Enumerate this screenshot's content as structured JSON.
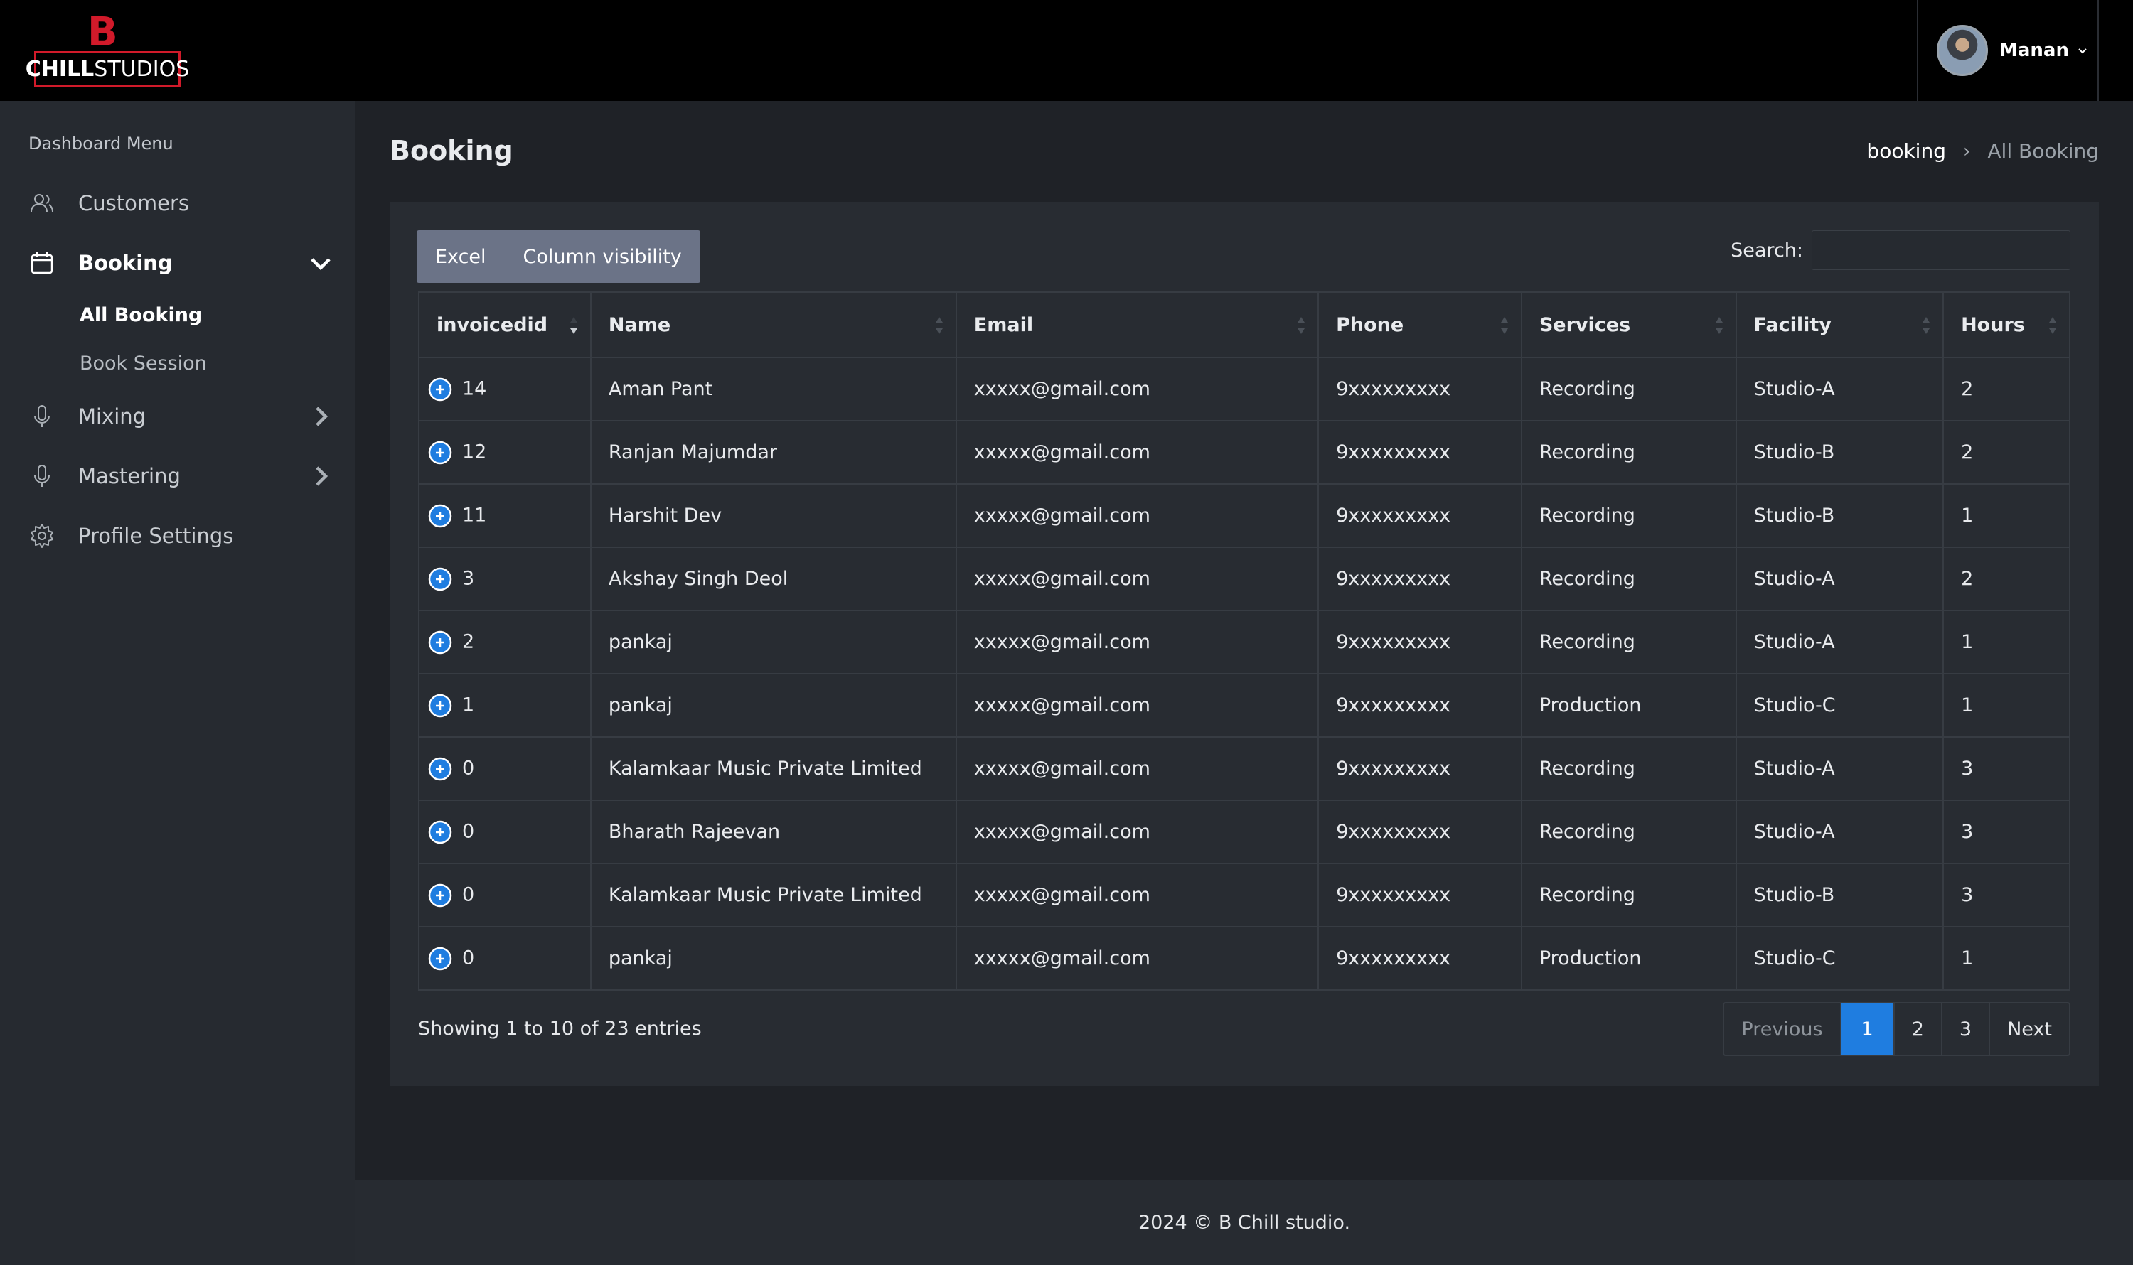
{
  "brand": {
    "logo_letter": "B",
    "logo_bold": "CHILL",
    "logo_light": "STUDIOS"
  },
  "user": {
    "name": "Manan"
  },
  "sidebar": {
    "menu_title": "Dashboard Menu",
    "items": [
      {
        "label": "Customers"
      },
      {
        "label": "Booking"
      },
      {
        "label": "Mixing"
      },
      {
        "label": "Mastering"
      },
      {
        "label": "Profile Settings"
      }
    ],
    "booking_sub": [
      {
        "label": "All Booking"
      },
      {
        "label": "Book Session"
      }
    ]
  },
  "page": {
    "title": "Booking",
    "breadcrumb": {
      "link": "booking",
      "current": "All Booking"
    }
  },
  "toolbar": {
    "excel": "Excel",
    "column_visibility": "Column visibility"
  },
  "search": {
    "label": "Search:",
    "value": ""
  },
  "table": {
    "headers": [
      "invoicedid",
      "Name",
      "Email",
      "Phone",
      "Services",
      "Facility",
      "Hours"
    ],
    "rows": [
      [
        "14",
        "Aman Pant",
        "xxxxx@gmail.com",
        "9xxxxxxxxx",
        "Recording",
        "Studio-A",
        "2"
      ],
      [
        "12",
        "Ranjan Majumdar",
        "xxxxx@gmail.com",
        "9xxxxxxxxx",
        "Recording",
        "Studio-B",
        "2"
      ],
      [
        "11",
        "Harshit Dev",
        "xxxxx@gmail.com",
        "9xxxxxxxxx",
        "Recording",
        "Studio-B",
        "1"
      ],
      [
        "3",
        "Akshay Singh Deol",
        "xxxxx@gmail.com",
        "9xxxxxxxxx",
        "Recording",
        "Studio-A",
        "2"
      ],
      [
        "2",
        "pankaj",
        "xxxxx@gmail.com",
        "9xxxxxxxxx",
        "Recording",
        "Studio-A",
        "1"
      ],
      [
        "1",
        "pankaj",
        "xxxxx@gmail.com",
        "9xxxxxxxxx",
        "Production",
        "Studio-C",
        "1"
      ],
      [
        "0",
        "Kalamkaar Music Private Limited",
        "xxxxx@gmail.com",
        "9xxxxxxxxx",
        "Recording",
        "Studio-A",
        "3"
      ],
      [
        "0",
        "Bharath Rajeevan",
        "xxxxx@gmail.com",
        "9xxxxxxxxx",
        "Recording",
        "Studio-A",
        "3"
      ],
      [
        "0",
        "Kalamkaar Music Private Limited",
        "xxxxx@gmail.com",
        "9xxxxxxxxx",
        "Recording",
        "Studio-B",
        "3"
      ],
      [
        "0",
        "pankaj",
        "xxxxx@gmail.com",
        "9xxxxxxxxx",
        "Production",
        "Studio-C",
        "1"
      ]
    ]
  },
  "pagination": {
    "info": "Showing 1 to 10 of 23 entries",
    "previous": "Previous",
    "pages": [
      "1",
      "2",
      "3"
    ],
    "next": "Next"
  },
  "footer": {
    "text": "2024 © B Chill studio."
  },
  "colors": {
    "accent": "#1f7de0",
    "brand_red": "#d11a2a"
  }
}
